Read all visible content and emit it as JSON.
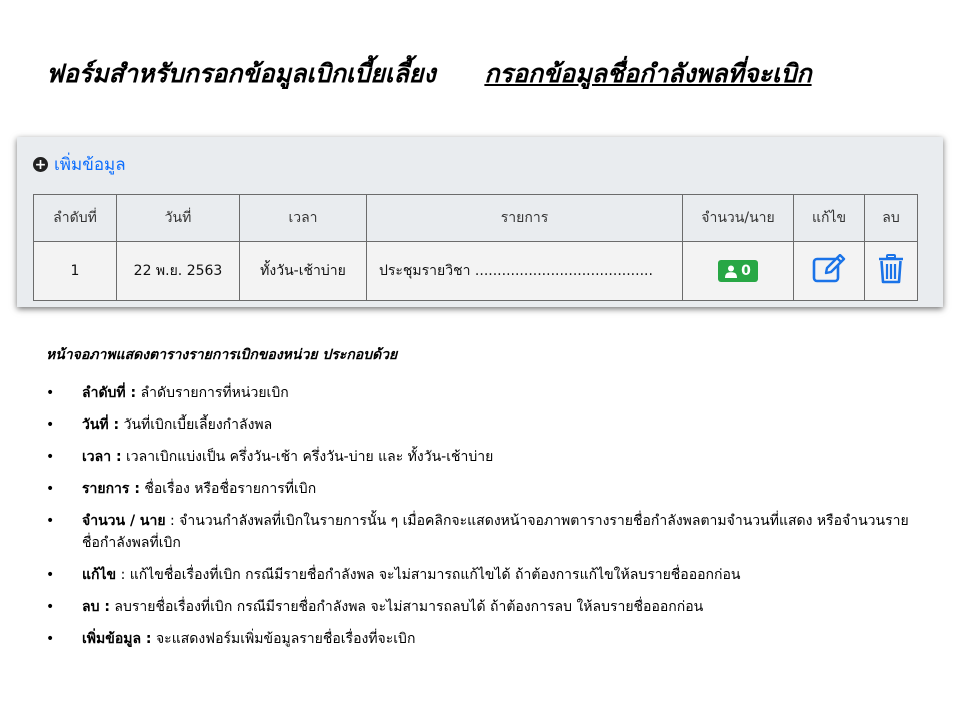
{
  "heading": {
    "main": "ฟอร์มสำหรับกรอกข้อมูลเบิกเบี้ยเลี้ยง",
    "sub": "กรอกข้อมูลชื่อกำลังพลที่จะเบิก"
  },
  "panel": {
    "add_label": "เพิ่มข้อมูล",
    "columns": [
      "ลำดับที่",
      "วันที่",
      "เวลา",
      "รายการ",
      "จำนวน/นาย",
      "แก้ไข",
      "ลบ"
    ],
    "rows": [
      {
        "no": "1",
        "date": "22 พ.ย. 2563",
        "time": "ทั้งวัน-เช้าบ่าย",
        "item": "ประชุมรายวิชา ........................................",
        "count": "0"
      }
    ],
    "colors": {
      "link": "#0d6efd",
      "badge": "#28a745",
      "icon": "#1a73e8"
    }
  },
  "description": {
    "title": "หน้าจอภาพแสดงตารางรายการเบิกของหน่วย  ประกอบด้วย",
    "bullet": "•",
    "items": [
      {
        "term": "ลำดับที่ :",
        "text": " ลำดับรายการที่หน่วยเบิก"
      },
      {
        "term": "วันที่ :",
        "text": " วันที่เบิกเบี้ยเลี้ยงกำลังพล"
      },
      {
        "term": "เวลา :",
        "text": " เวลาเบิกแบ่งเป็น ครึ่งวัน-เช้า ครึ่งวัน-บ่าย และ ทั้งวัน-เช้าบ่าย"
      },
      {
        "term": "รายการ :",
        "text": " ชื่อเรื่อง หรือชื่อรายการที่เบิก"
      },
      {
        "term": "จำนวน / นาย",
        "text": " :   จำนวนกำลังพลที่เบิกในรายการนั้น ๆ   เมื่อคลิกจะแสดงหน้าจอภาพตารางรายชื่อกำลังพลตามจำนวนที่แสดง หรือจำนวนรายชื่อกำลังพลที่เบิก"
      },
      {
        "term": "แก้ไข",
        "text": "   :   แก้ไขชื่อเรื่องที่เบิก กรณีมีรายชื่อกำลังพล จะไม่สามารถแก้ไขได้ ถ้าต้องการแก้ไขให้ลบรายชื่อออกก่อน"
      },
      {
        "term": "ลบ :",
        "text": " ลบรายชื่อเรื่องที่เบิก กรณีมีรายชื่อกำลังพล จะไม่สามารถลบได้ ถ้าต้องการลบ ให้ลบรายชื่อออกก่อน"
      },
      {
        "term": "เพิ่มข้อมูล :",
        "text": " จะแสดงฟอร์มเพิ่มข้อมูลรายชื่อเรื่องที่จะเบิก"
      }
    ]
  }
}
